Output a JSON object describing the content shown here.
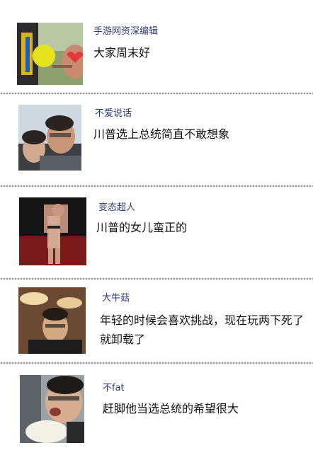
{
  "posts": [
    {
      "username": "手游网资深编辑",
      "message": "大家周末好"
    },
    {
      "username": "不爱说话",
      "message": "川普选上总统简直不敢想象"
    },
    {
      "username": "变态超人",
      "message": "川普的女儿蛮正的"
    },
    {
      "username": "大牛菇",
      "message": "年轻的时候会喜欢挑战，现在玩两下死了就卸载了"
    },
    {
      "username": "不fat",
      "message": "赶脚他当选总统的希望很大"
    }
  ]
}
